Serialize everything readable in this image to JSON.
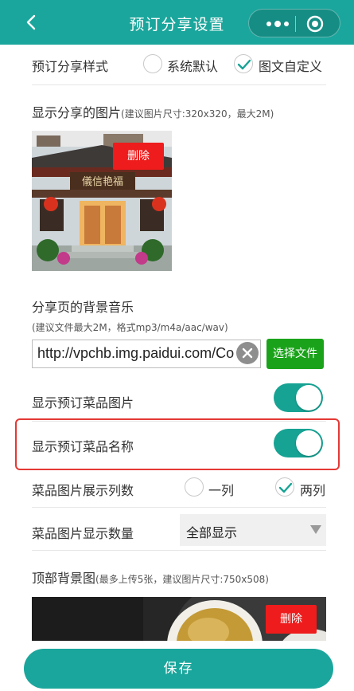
{
  "header": {
    "title": "预订分享设置"
  },
  "share_style": {
    "label": "预订分享样式",
    "options": [
      {
        "label": "系统默认",
        "checked": false
      },
      {
        "label": "图文自定义",
        "checked": true
      }
    ]
  },
  "share_image": {
    "title": "显示分享的图片",
    "hint": "(建议图片尺寸:320x320，最大2M)",
    "sign_text": "儀信艳福",
    "delete_label": "删除"
  },
  "music": {
    "title": "分享页的背景音乐",
    "hint": "(建议文件最大2M，格式mp3/m4a/aac/wav)",
    "url_value": "http://vpchb.img.paidui.com/Co",
    "choose_label": "选择文件"
  },
  "show_dish_image": {
    "label": "显示预订菜品图片",
    "on": true
  },
  "show_dish_name": {
    "label": "显示预订菜品名称",
    "on": true
  },
  "columns": {
    "label": "菜品图片展示列数",
    "options": [
      {
        "label": "一列",
        "checked": false
      },
      {
        "label": "两列",
        "checked": true
      }
    ]
  },
  "display_count": {
    "label": "菜品图片显示数量",
    "value": "全部显示"
  },
  "top_bg": {
    "title": "顶部背景图",
    "hint": "(最多上传5张，建议图片尺寸:750x508)",
    "delete_label": "删除"
  },
  "footer": {
    "save_label": "保存"
  },
  "colors": {
    "accent": "#1aa69c",
    "danger": "#ee1c1c",
    "primary_green": "#1aa31a"
  }
}
